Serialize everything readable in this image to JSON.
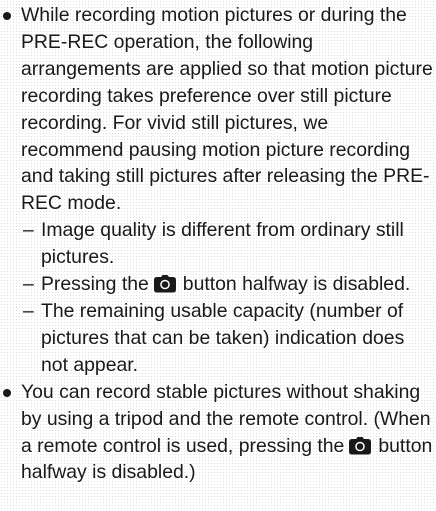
{
  "bullets": [
    {
      "text": "While recording motion pictures or during the PRE-REC operation, the following arrangements are applied so that motion picture recording takes preference over still picture recording. For vivid still pictures, we recommend pausing motion picture recording and taking still pictures after releasing the PRE-REC mode.",
      "sub_items": [
        {
          "text": "Image quality is different from ordinary still pictures."
        },
        {
          "before_icon": "Pressing the",
          "icon": "camera-icon",
          "after_icon": "button halfway is disabled."
        },
        {
          "text": "The remaining usable capacity (number of pictures that can be taken) indication does not appear."
        }
      ]
    },
    {
      "text_before_icon": "You can record stable pictures without shaking by using a tripod and the remote control. (When a remote control is used, pressing the",
      "icon": "camera-icon",
      "text_after_icon": "button halfway is disabled.)"
    }
  ],
  "dash": "–",
  "colors": {
    "text": "#1a1a1a",
    "icon": "#1a1a1a"
  }
}
